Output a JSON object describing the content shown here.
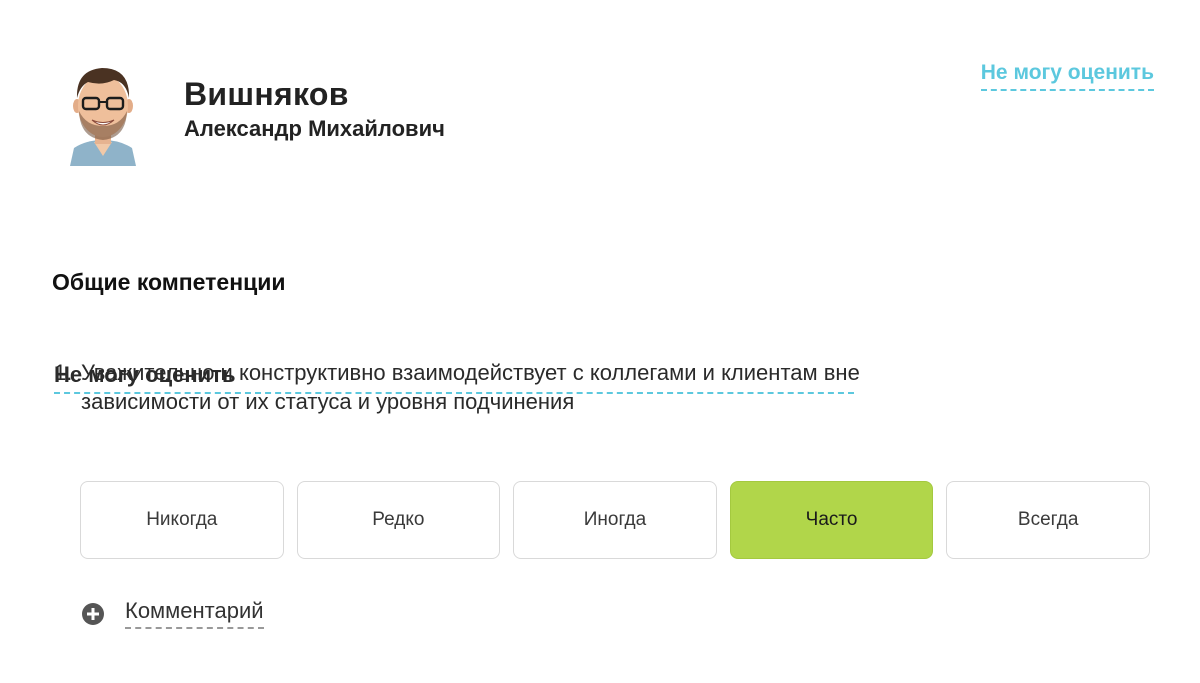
{
  "person": {
    "last_name": "Вишняков",
    "first_middle_name": "Александр Михайлович",
    "avatar_icon": "avatar-photo"
  },
  "cant_rate_label": "Не могу оценить",
  "section": {
    "title": "Общие компетенции"
  },
  "question": {
    "number": "1.",
    "text": "Уважительно и конструктивно взаимодействует с коллегами и клиентам вне зависимости от их статуса и уровня подчинения",
    "options": [
      "Никогда",
      "Редко",
      "Иногда",
      "Часто",
      "Всегда"
    ],
    "selected": "Часто",
    "comment_label": "Комментарий",
    "comment_icon": "plus-circle-icon"
  },
  "colors": {
    "accent": "#5cc8de",
    "selected": "#b1d64a"
  }
}
